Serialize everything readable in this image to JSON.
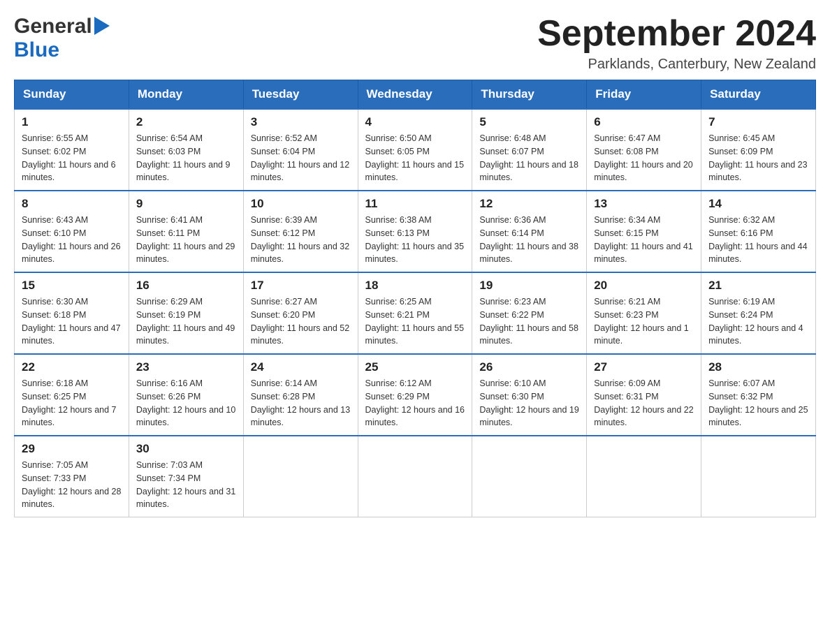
{
  "logo": {
    "text_general": "General",
    "text_blue": "Blue",
    "aria": "GeneralBlue logo"
  },
  "header": {
    "month_title": "September 2024",
    "location": "Parklands, Canterbury, New Zealand"
  },
  "weekdays": [
    "Sunday",
    "Monday",
    "Tuesday",
    "Wednesday",
    "Thursday",
    "Friday",
    "Saturday"
  ],
  "weeks": [
    [
      {
        "day": "1",
        "sunrise": "6:55 AM",
        "sunset": "6:02 PM",
        "daylight": "11 hours and 6 minutes."
      },
      {
        "day": "2",
        "sunrise": "6:54 AM",
        "sunset": "6:03 PM",
        "daylight": "11 hours and 9 minutes."
      },
      {
        "day": "3",
        "sunrise": "6:52 AM",
        "sunset": "6:04 PM",
        "daylight": "11 hours and 12 minutes."
      },
      {
        "day": "4",
        "sunrise": "6:50 AM",
        "sunset": "6:05 PM",
        "daylight": "11 hours and 15 minutes."
      },
      {
        "day": "5",
        "sunrise": "6:48 AM",
        "sunset": "6:07 PM",
        "daylight": "11 hours and 18 minutes."
      },
      {
        "day": "6",
        "sunrise": "6:47 AM",
        "sunset": "6:08 PM",
        "daylight": "11 hours and 20 minutes."
      },
      {
        "day": "7",
        "sunrise": "6:45 AM",
        "sunset": "6:09 PM",
        "daylight": "11 hours and 23 minutes."
      }
    ],
    [
      {
        "day": "8",
        "sunrise": "6:43 AM",
        "sunset": "6:10 PM",
        "daylight": "11 hours and 26 minutes."
      },
      {
        "day": "9",
        "sunrise": "6:41 AM",
        "sunset": "6:11 PM",
        "daylight": "11 hours and 29 minutes."
      },
      {
        "day": "10",
        "sunrise": "6:39 AM",
        "sunset": "6:12 PM",
        "daylight": "11 hours and 32 minutes."
      },
      {
        "day": "11",
        "sunrise": "6:38 AM",
        "sunset": "6:13 PM",
        "daylight": "11 hours and 35 minutes."
      },
      {
        "day": "12",
        "sunrise": "6:36 AM",
        "sunset": "6:14 PM",
        "daylight": "11 hours and 38 minutes."
      },
      {
        "day": "13",
        "sunrise": "6:34 AM",
        "sunset": "6:15 PM",
        "daylight": "11 hours and 41 minutes."
      },
      {
        "day": "14",
        "sunrise": "6:32 AM",
        "sunset": "6:16 PM",
        "daylight": "11 hours and 44 minutes."
      }
    ],
    [
      {
        "day": "15",
        "sunrise": "6:30 AM",
        "sunset": "6:18 PM",
        "daylight": "11 hours and 47 minutes."
      },
      {
        "day": "16",
        "sunrise": "6:29 AM",
        "sunset": "6:19 PM",
        "daylight": "11 hours and 49 minutes."
      },
      {
        "day": "17",
        "sunrise": "6:27 AM",
        "sunset": "6:20 PM",
        "daylight": "11 hours and 52 minutes."
      },
      {
        "day": "18",
        "sunrise": "6:25 AM",
        "sunset": "6:21 PM",
        "daylight": "11 hours and 55 minutes."
      },
      {
        "day": "19",
        "sunrise": "6:23 AM",
        "sunset": "6:22 PM",
        "daylight": "11 hours and 58 minutes."
      },
      {
        "day": "20",
        "sunrise": "6:21 AM",
        "sunset": "6:23 PM",
        "daylight": "12 hours and 1 minute."
      },
      {
        "day": "21",
        "sunrise": "6:19 AM",
        "sunset": "6:24 PM",
        "daylight": "12 hours and 4 minutes."
      }
    ],
    [
      {
        "day": "22",
        "sunrise": "6:18 AM",
        "sunset": "6:25 PM",
        "daylight": "12 hours and 7 minutes."
      },
      {
        "day": "23",
        "sunrise": "6:16 AM",
        "sunset": "6:26 PM",
        "daylight": "12 hours and 10 minutes."
      },
      {
        "day": "24",
        "sunrise": "6:14 AM",
        "sunset": "6:28 PM",
        "daylight": "12 hours and 13 minutes."
      },
      {
        "day": "25",
        "sunrise": "6:12 AM",
        "sunset": "6:29 PM",
        "daylight": "12 hours and 16 minutes."
      },
      {
        "day": "26",
        "sunrise": "6:10 AM",
        "sunset": "6:30 PM",
        "daylight": "12 hours and 19 minutes."
      },
      {
        "day": "27",
        "sunrise": "6:09 AM",
        "sunset": "6:31 PM",
        "daylight": "12 hours and 22 minutes."
      },
      {
        "day": "28",
        "sunrise": "6:07 AM",
        "sunset": "6:32 PM",
        "daylight": "12 hours and 25 minutes."
      }
    ],
    [
      {
        "day": "29",
        "sunrise": "7:05 AM",
        "sunset": "7:33 PM",
        "daylight": "12 hours and 28 minutes."
      },
      {
        "day": "30",
        "sunrise": "7:03 AM",
        "sunset": "7:34 PM",
        "daylight": "12 hours and 31 minutes."
      },
      null,
      null,
      null,
      null,
      null
    ]
  ],
  "labels": {
    "sunrise": "Sunrise:",
    "sunset": "Sunset:",
    "daylight": "Daylight:"
  }
}
